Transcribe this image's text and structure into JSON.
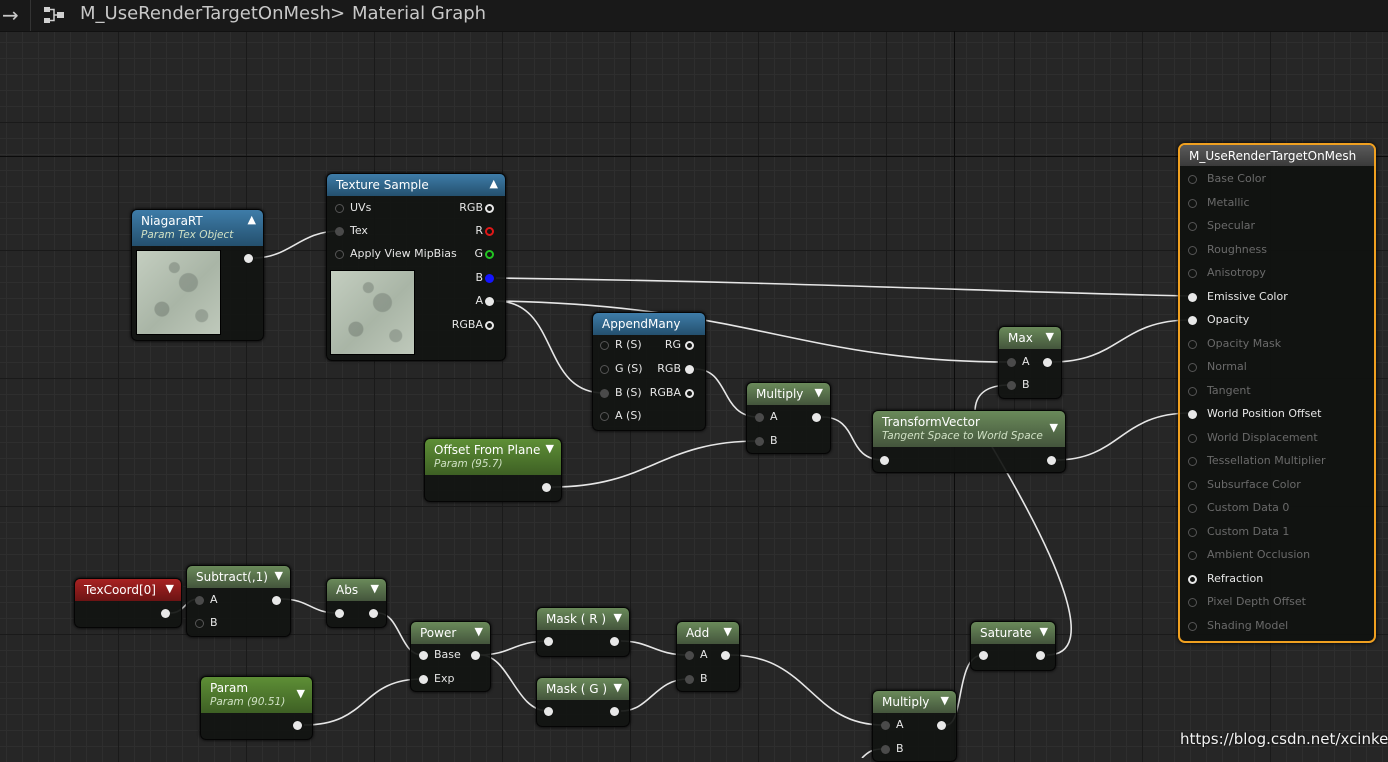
{
  "toolbar": {
    "asset_name": "M_UseRenderTargetOnMesh",
    "separator": ">",
    "graph_name": "Material Graph"
  },
  "nodes": {
    "niagara_rt": {
      "title": "NiagaraRT",
      "subtitle": "Param Tex Object"
    },
    "texture_sample": {
      "title": "Texture Sample",
      "inputs": [
        "UVs",
        "Tex",
        "Apply View MipBias"
      ],
      "outputs": [
        "RGB",
        "R",
        "G",
        "B",
        "A",
        "RGBA"
      ]
    },
    "append_many": {
      "title": "AppendMany",
      "inputs": [
        "R (S)",
        "G (S)",
        "B (S)",
        "A (S)"
      ],
      "outputs": [
        "RG",
        "RGB",
        "RGBA"
      ]
    },
    "offset_from_plane": {
      "title": "Offset From Plane",
      "subtitle": "Param (95.7)"
    },
    "multiply1": {
      "title": "Multiply",
      "inputs": [
        "A",
        "B"
      ]
    },
    "max": {
      "title": "Max",
      "inputs": [
        "A",
        "B"
      ]
    },
    "transform_vector": {
      "title": "TransformVector",
      "subtitle": "Tangent Space to World Space"
    },
    "texcoord": {
      "title": "TexCoord[0]"
    },
    "subtract": {
      "title": "Subtract(,1)",
      "inputs": [
        "A",
        "B"
      ]
    },
    "abs": {
      "title": "Abs"
    },
    "power": {
      "title": "Power",
      "inputs": [
        "Base",
        "Exp"
      ]
    },
    "param": {
      "title": "Param",
      "subtitle": "Param (90.51)"
    },
    "mask_r": {
      "title": "Mask ( R )"
    },
    "mask_g": {
      "title": "Mask ( G )"
    },
    "add": {
      "title": "Add",
      "inputs": [
        "A",
        "B"
      ]
    },
    "multiply2": {
      "title": "Multiply",
      "inputs": [
        "A",
        "B"
      ]
    },
    "saturate": {
      "title": "Saturate"
    }
  },
  "result_node": {
    "title": "M_UseRenderTargetOnMesh",
    "pins": [
      {
        "label": "Base Color",
        "active": false
      },
      {
        "label": "Metallic",
        "active": false
      },
      {
        "label": "Specular",
        "active": false
      },
      {
        "label": "Roughness",
        "active": false
      },
      {
        "label": "Anisotropy",
        "active": false
      },
      {
        "label": "Emissive Color",
        "active": true
      },
      {
        "label": "Opacity",
        "active": true
      },
      {
        "label": "Opacity Mask",
        "active": false
      },
      {
        "label": "Normal",
        "active": false
      },
      {
        "label": "Tangent",
        "active": false
      },
      {
        "label": "World Position Offset",
        "active": true
      },
      {
        "label": "World Displacement",
        "active": false
      },
      {
        "label": "Tessellation Multiplier",
        "active": false
      },
      {
        "label": "Subsurface Color",
        "active": false
      },
      {
        "label": "Custom Data 0",
        "active": false
      },
      {
        "label": "Custom Data 1",
        "active": false
      },
      {
        "label": "Ambient Occlusion",
        "active": false
      },
      {
        "label": "Refraction",
        "active": true
      },
      {
        "label": "Pixel Depth Offset",
        "active": false
      },
      {
        "label": "Shading Model",
        "active": false
      }
    ]
  },
  "watermark": "https://blog.csdn.net/xcinkey"
}
